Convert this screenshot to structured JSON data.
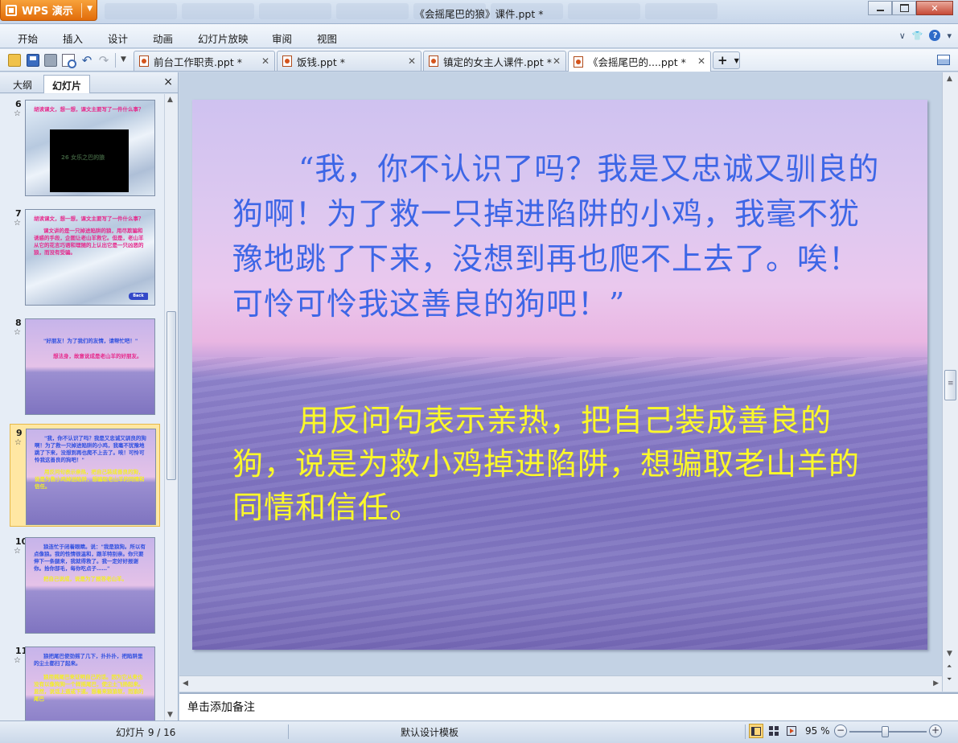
{
  "app": {
    "button_label": "WPS 演示",
    "window_title": "《会摇尾巴的狼》课件.ppt *"
  },
  "menu": {
    "items": [
      "开始",
      "插入",
      "设计",
      "动画",
      "幻灯片放映",
      "审阅",
      "视图"
    ]
  },
  "tabs": [
    {
      "label": "前台工作职责.ppt *",
      "active": false
    },
    {
      "label": "饭钱.ppt *",
      "active": false
    },
    {
      "label": "镇定的女主人课件.ppt *",
      "active": false
    },
    {
      "label": "《会摇尾巴的....ppt *",
      "active": true
    }
  ],
  "left_panel": {
    "tab_outline": "大纲",
    "tab_slides": "幻灯片",
    "close": "×",
    "thumbnails": [
      {
        "num": "6",
        "lines": [
          "胡读课文，想一想，课文主要写了一件什么事？"
        ],
        "black_box": "26 女乐之巴的狼"
      },
      {
        "num": "7",
        "lines": [
          "胡读课文，想一想，课文主要写了一件什么事？",
          "课文讲的是一只掉进陷阱的狼，用尽欺骗和诱惑的手段，企图让老山羊救它。但是，老山羊从它的花言巧语和理随的上认出它是一只凶恶的狼，而没有受骗。"
        ],
        "back": "Back"
      },
      {
        "num": "8",
        "lines": [
          "\"好朋友！为了我们的友情，请帮忙吧！\"",
          "想法身，故意说成是老山羊的好朋友。"
        ]
      },
      {
        "num": "9",
        "lines": [
          "\"我，你不认识了吗？我是又忠诚又驯良的狗啊！为了救一只掉进陷阱的小鸡，我毫不犹豫地跳了下来，没想到再也爬不上去了。唉！可怜可怜我这善良的狗吧！\"",
          "用反问句表示亲热，把自己装成善良的狗，说是为救小鸡掉进陷阱，想骗取老山羊的同情和信任。"
        ]
      },
      {
        "num": "10",
        "lines": [
          "狼连忙于闭着眼睛。说：\"我是狼狗。所以有点像狼。我的性情很温和，跟羊特别亲。你只要伸下一条腿来，我就得救了。我一定好好报谢你。拾你部毛，每你吃点子……\"",
          "把自己说成，说是为了报答老山羊。"
        ]
      },
      {
        "num": "11",
        "lines": [
          "狼把尾巴使劲摇了几下，扑扑扑，把陷阱里的尘土都扫了起来。",
          "狼用摇尾巴来证明自己的话。因为它从来也没有以像狗狗一个样摇尾巴，使尘土飞扬起来。显然，说话上道或下道。想着来狼狼软，而狼的尾巴"
        ]
      }
    ]
  },
  "slide": {
    "quote": "“我，你不认识了吗？我是又忠诚又驯良的狗啊！为了救一只掉进陷阱的小鸡，我毫不犹豫地跳了下来，没想到再也爬不上去了。唉！可怜可怜我这善良的狗吧！”",
    "analysis": "用反问句表示亲热，把自己装成善良的狗，说是为救小鸡掉进陷阱，想骗取老山羊的同情和信任。"
  },
  "notes": {
    "placeholder": "单击添加备注"
  },
  "status": {
    "slide_counter": "幻灯片 9 / 16",
    "template": "默认设计模板",
    "zoom": "95 %"
  },
  "colors": {
    "quote_text": "#3d66e6",
    "analysis_text": "#fbf82a",
    "app_button": "#f08a1c",
    "selected_thumb": "#ffe7a3"
  }
}
